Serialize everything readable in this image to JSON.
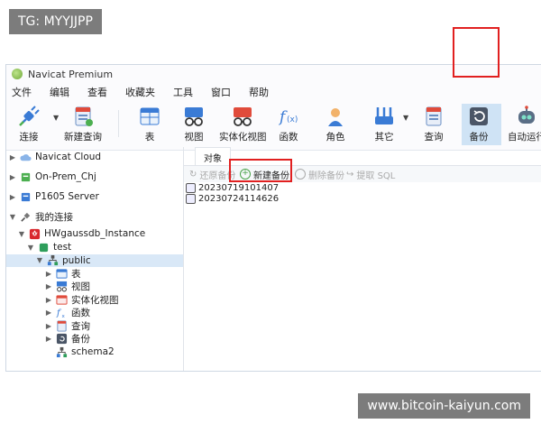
{
  "watermarks": {
    "top": "TG: MYYJJPP",
    "bottom": "www.bitcoin-kaiyun.com"
  },
  "window": {
    "title": "Navicat Premium"
  },
  "menu": [
    "文件",
    "编辑",
    "查看",
    "收藏夹",
    "工具",
    "窗口",
    "帮助"
  ],
  "toolbar": [
    {
      "label": "连接",
      "icon": "plug-icon"
    },
    {
      "label": "新建查询",
      "icon": "new-query-icon"
    },
    {
      "label": "表",
      "icon": "table-icon"
    },
    {
      "label": "视图",
      "icon": "view-icon"
    },
    {
      "label": "实体化视图",
      "icon": "materialized-view-icon"
    },
    {
      "label": "函数",
      "icon": "function-icon"
    },
    {
      "label": "角色",
      "icon": "role-icon"
    },
    {
      "label": "其它",
      "icon": "tools-icon"
    },
    {
      "label": "查询",
      "icon": "query-icon"
    },
    {
      "label": "备份",
      "icon": "backup-icon"
    },
    {
      "label": "自动运行",
      "icon": "robot-icon"
    }
  ],
  "tree": [
    {
      "label": "Navicat Cloud",
      "icon": "cloud-icon"
    },
    {
      "label": "On-Prem_Chj",
      "icon": "server-icon"
    },
    {
      "label": "P1605 Server",
      "icon": "server-icon"
    },
    {
      "label": "我的连接",
      "icon": "connection-icon"
    },
    {
      "label": "HWgaussdb_Instance",
      "icon": "huawei-icon"
    },
    {
      "label": "test",
      "icon": "database-icon"
    },
    {
      "label": "public",
      "icon": "schema-icon"
    },
    {
      "label": "表",
      "icon": "table-icon"
    },
    {
      "label": "视图",
      "icon": "view-icon"
    },
    {
      "label": "实体化视图",
      "icon": "materialized-view-icon"
    },
    {
      "label": "函数",
      "icon": "function-icon"
    },
    {
      "label": "查询",
      "icon": "query-icon"
    },
    {
      "label": "备份",
      "icon": "backup-icon"
    },
    {
      "label": "schema2",
      "icon": "schema-icon"
    }
  ],
  "main": {
    "tab": "对象",
    "actions": {
      "restore": "还原备份",
      "new_backup": "新建备份",
      "delete": "删除备份",
      "extract_sql": "提取 SQL"
    },
    "files": [
      "20230719101407",
      "20230724114626"
    ]
  },
  "colors": {
    "accent": "#cfe3f5",
    "highlight": "#e12020",
    "selected_row": "#d9e8f7"
  }
}
